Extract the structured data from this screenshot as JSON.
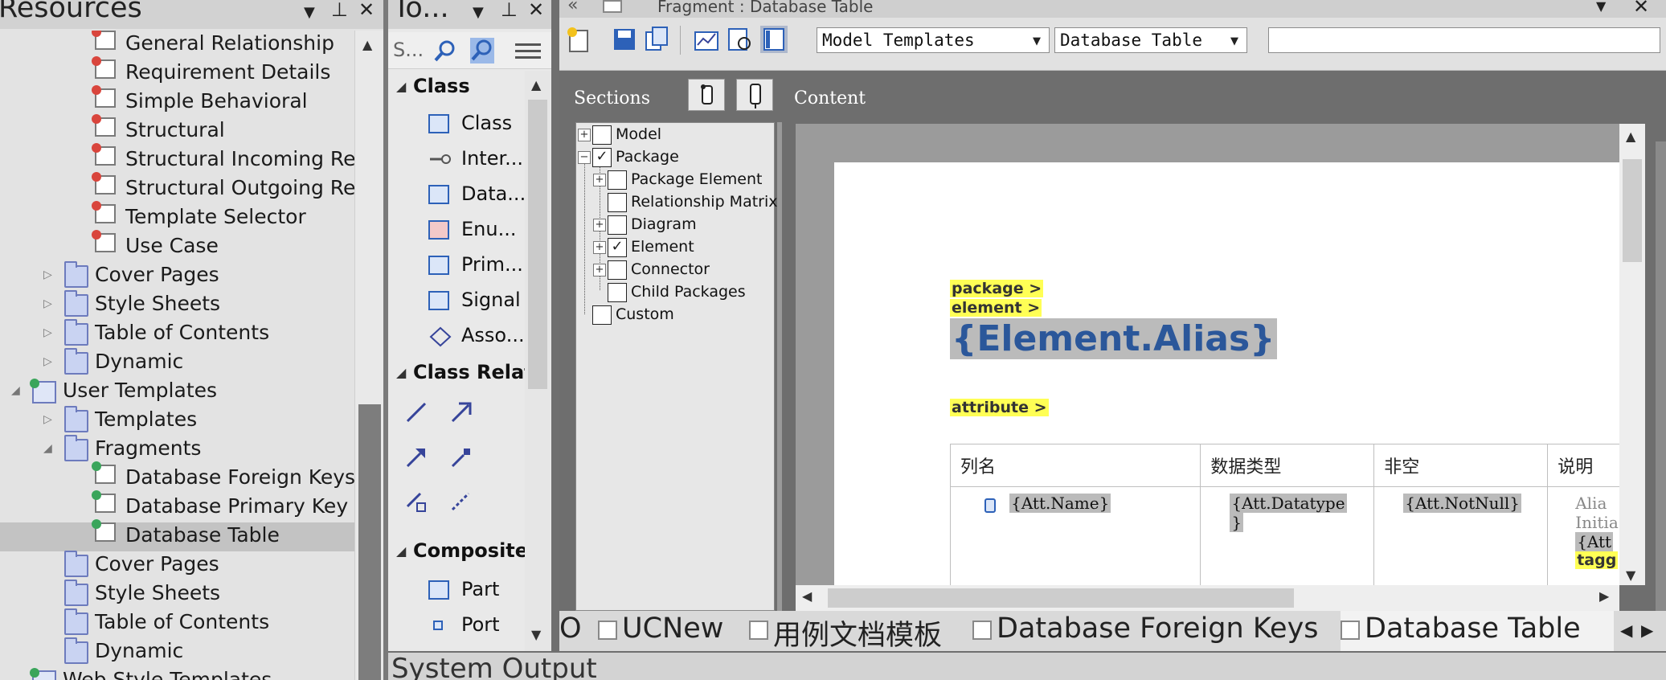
{
  "resources": {
    "title": "Resources",
    "items": [
      {
        "label": "General Relationship",
        "kind": "tpl-red"
      },
      {
        "label": "Requirement Details",
        "kind": "tpl-red"
      },
      {
        "label": "Simple Behavioral",
        "kind": "tpl-red"
      },
      {
        "label": "Structural",
        "kind": "tpl-red"
      },
      {
        "label": "Structural Incoming Relat",
        "kind": "tpl-red"
      },
      {
        "label": "Structural Outgoing Rela",
        "kind": "tpl-red"
      },
      {
        "label": "Template Selector",
        "kind": "tpl-red"
      },
      {
        "label": "Use Case",
        "kind": "tpl-red"
      },
      {
        "label": "Cover Pages",
        "kind": "folder"
      },
      {
        "label": "Style Sheets",
        "kind": "folder"
      },
      {
        "label": "Table of Contents",
        "kind": "folder"
      },
      {
        "label": "Dynamic",
        "kind": "folder"
      },
      {
        "label": "User Templates",
        "kind": "user-templates"
      },
      {
        "label": "Templates",
        "kind": "folder"
      },
      {
        "label": "Fragments",
        "kind": "folder"
      },
      {
        "label": "Database Foreign Keys",
        "kind": "tpl-green"
      },
      {
        "label": "Database Primary Key",
        "kind": "tpl-green"
      },
      {
        "label": "Database Table",
        "kind": "tpl-green",
        "selected": true
      },
      {
        "label": "Cover Pages",
        "kind": "folder"
      },
      {
        "label": "Style Sheets",
        "kind": "folder"
      },
      {
        "label": "Table of Contents",
        "kind": "folder"
      },
      {
        "label": "Dynamic",
        "kind": "folder"
      },
      {
        "label": "Web Style Templates",
        "kind": "user-templates"
      }
    ]
  },
  "toolbox": {
    "title": "To...",
    "search_placeholder": "S...",
    "sections": {
      "class": "Class",
      "class_relations": "Class Relatio",
      "composite": "Composite F"
    },
    "class_items": [
      "Class",
      "Inter...",
      "Data...",
      "Enu...",
      "Prim...",
      "Signal",
      "Asso..."
    ],
    "composite_items": [
      "Part",
      "Port"
    ]
  },
  "editor": {
    "tab_title": "Fragment : Database Table",
    "combo_templates": "Model Templates",
    "combo_table": "Database Table",
    "sections_label": "Sections",
    "content_label": "Content",
    "tree": [
      {
        "label": "Model",
        "checked": false
      },
      {
        "label": "Package",
        "checked": true
      },
      {
        "label": "Package Element",
        "checked": false
      },
      {
        "label": "Relationship Matrix",
        "checked": false
      },
      {
        "label": "Diagram",
        "checked": false
      },
      {
        "label": "Element",
        "checked": true
      },
      {
        "label": "Connector",
        "checked": false
      },
      {
        "label": "Child Packages",
        "checked": false
      },
      {
        "label": "Custom",
        "checked": false
      }
    ],
    "doc": {
      "tag_package": "package >",
      "tag_element": "element >",
      "element_alias": "{Element.Alias}",
      "tag_attribute": "attribute >",
      "headers": [
        "列名",
        "数据类型",
        "非空",
        "说明"
      ],
      "cell_name": "{Att.Name}",
      "cell_type_1": "{Att.Datatype",
      "cell_type_2": "}",
      "cell_notnull": "{Att.NotNull}",
      "cell_desc_1": "Alia",
      "cell_desc_2": "Initia",
      "cell_desc_3": "{Att",
      "cell_desc_4": "tagg"
    },
    "doc_tabs": [
      "O",
      "UCNew",
      "用例文档模板",
      "Database Foreign Keys",
      "Database Table"
    ]
  },
  "system_output": "System Output"
}
